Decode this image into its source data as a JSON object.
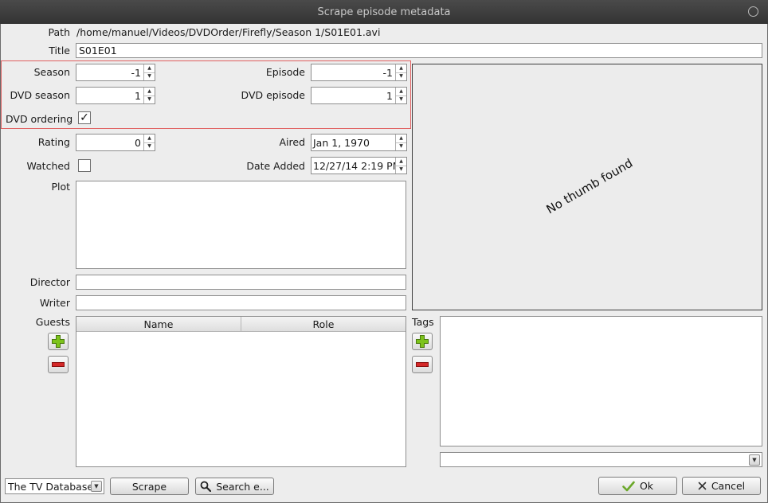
{
  "window": {
    "title": "Scrape episode metadata"
  },
  "labels": {
    "path": "Path",
    "title": "Title",
    "season": "Season",
    "episode": "Episode",
    "dvd_season": "DVD season",
    "dvd_episode": "DVD episode",
    "dvd_ordering": "DVD ordering",
    "rating": "Rating",
    "aired": "Aired",
    "watched": "Watched",
    "date_added": "Date Added",
    "plot": "Plot",
    "director": "Director",
    "writer": "Writer",
    "guests": "Guests",
    "tags": "Tags"
  },
  "values": {
    "path": "/home/manuel/Videos/DVDOrder/Firefly/Season 1/S01E01.avi",
    "title": "S01E01",
    "season": "-1",
    "episode": "-1",
    "dvd_season": "1",
    "dvd_episode": "1",
    "dvd_ordering_checked": true,
    "dvd_ordering_mark": "✓",
    "rating": "0",
    "aired": "Jan 1, 1970",
    "watched_checked": false,
    "date_added": "12/27/14 2:19 PM",
    "plot": "",
    "director": "",
    "writer": "",
    "tag_input": ""
  },
  "thumb": {
    "placeholder": "No thumb found"
  },
  "guests_table": {
    "columns": [
      "Name",
      "Role"
    ],
    "rows": []
  },
  "footer": {
    "scraper_selected": "The TV Database",
    "scrape_label": "Scrape",
    "search_label": "Search e...",
    "ok_label": "Ok",
    "cancel_label": "Cancel"
  },
  "icons": {
    "add": "plus-icon",
    "remove": "minus-icon",
    "search": "magnifier-icon",
    "ok": "checkmark-icon",
    "cancel": "x-icon"
  },
  "colors": {
    "highlight": "#e06060",
    "add_green": "#7cc31b",
    "remove_red": "#d42828",
    "ok_green": "#6ba82a"
  }
}
